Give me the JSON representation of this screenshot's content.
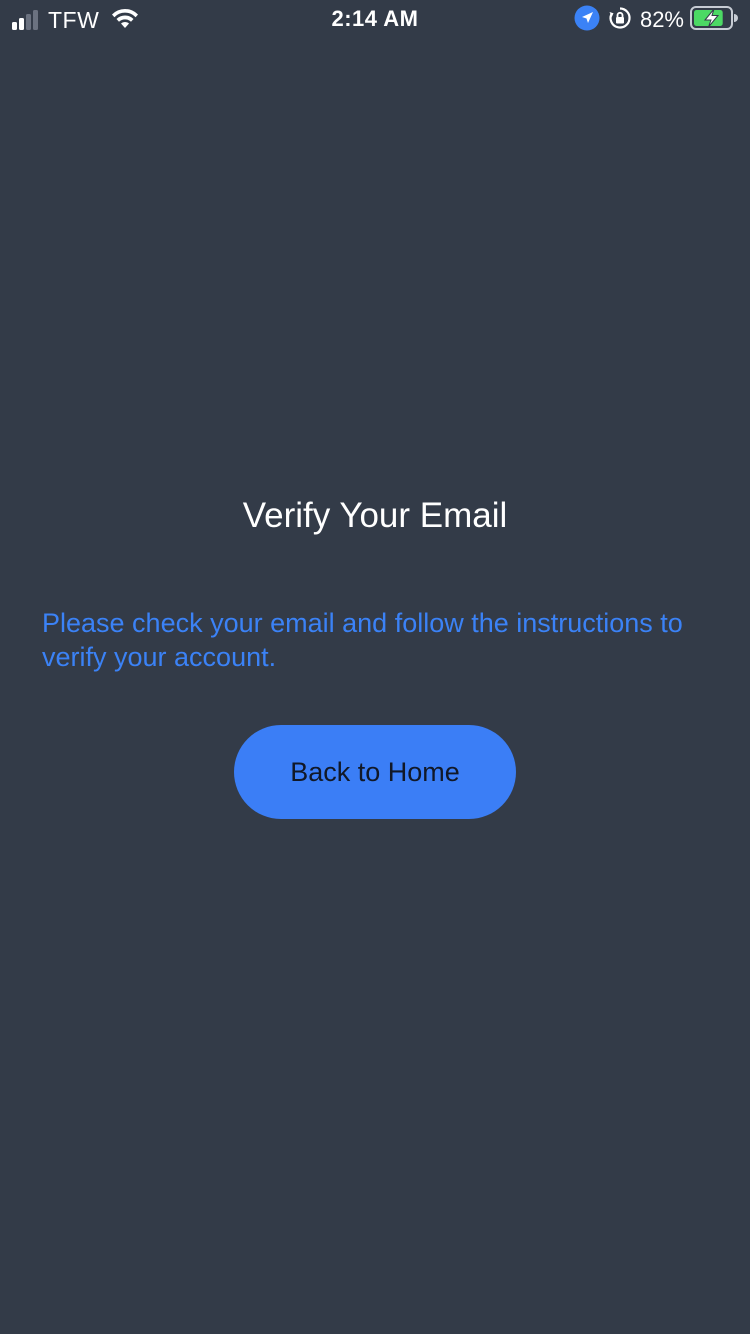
{
  "status_bar": {
    "carrier": "TFW",
    "time": "2:14 AM",
    "battery_percent": "82%",
    "signal_bars_active": 2,
    "signal_bars_total": 4,
    "icons": [
      "signal-icon",
      "wifi-icon",
      "location-icon",
      "orientation-lock-icon",
      "battery-charging-icon"
    ],
    "battery_level": 0.82
  },
  "screen": {
    "title": "Verify Your Email",
    "message": "Please check your email and follow the instructions to verify your account.",
    "button_label": "Back to Home"
  },
  "colors": {
    "background": "#333b48",
    "accent": "#3b82f6",
    "button_text": "#111827",
    "battery_green": "#4cd964"
  }
}
